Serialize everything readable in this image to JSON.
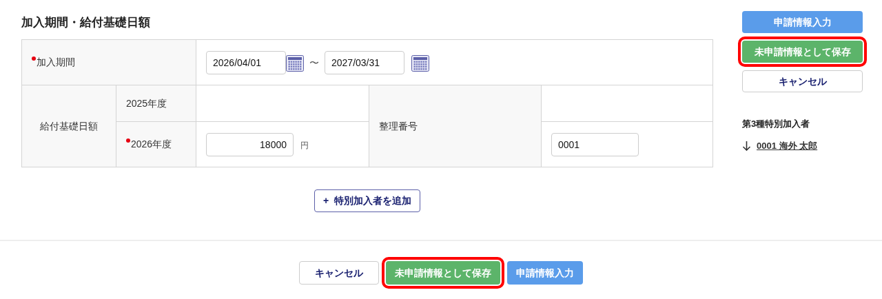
{
  "section_title": "加入期間・給付基礎日額",
  "period": {
    "label": "加入期間",
    "required": true,
    "start": "2026/04/01",
    "separator": "〜",
    "end": "2027/03/31"
  },
  "benefit": {
    "label": "給付基礎日額",
    "years": [
      {
        "label": "2025年度",
        "required": false
      },
      {
        "label": "2026年度",
        "required": true,
        "value": "18000",
        "unit": "円"
      }
    ]
  },
  "ref_number": {
    "label": "整理番号",
    "value": "0001"
  },
  "add_button": {
    "icon": "+",
    "label": "特別加入者を追加"
  },
  "side_buttons": [
    {
      "kind": "primary",
      "label": "申請情報入力",
      "highlighted": false
    },
    {
      "kind": "success",
      "label": "未申請情報として保存",
      "highlighted": true
    },
    {
      "kind": "outline",
      "label": "キャンセル",
      "highlighted": false
    }
  ],
  "side_section": {
    "title": "第3種特別加入者",
    "links": [
      {
        "label": "0001 海外 太郎"
      }
    ]
  },
  "footer_buttons": [
    {
      "kind": "outline",
      "label": "キャンセル",
      "highlighted": false
    },
    {
      "kind": "success",
      "label": "未申請情報として保存",
      "highlighted": true
    },
    {
      "kind": "primary",
      "label": "申請情報入力",
      "highlighted": false
    }
  ]
}
